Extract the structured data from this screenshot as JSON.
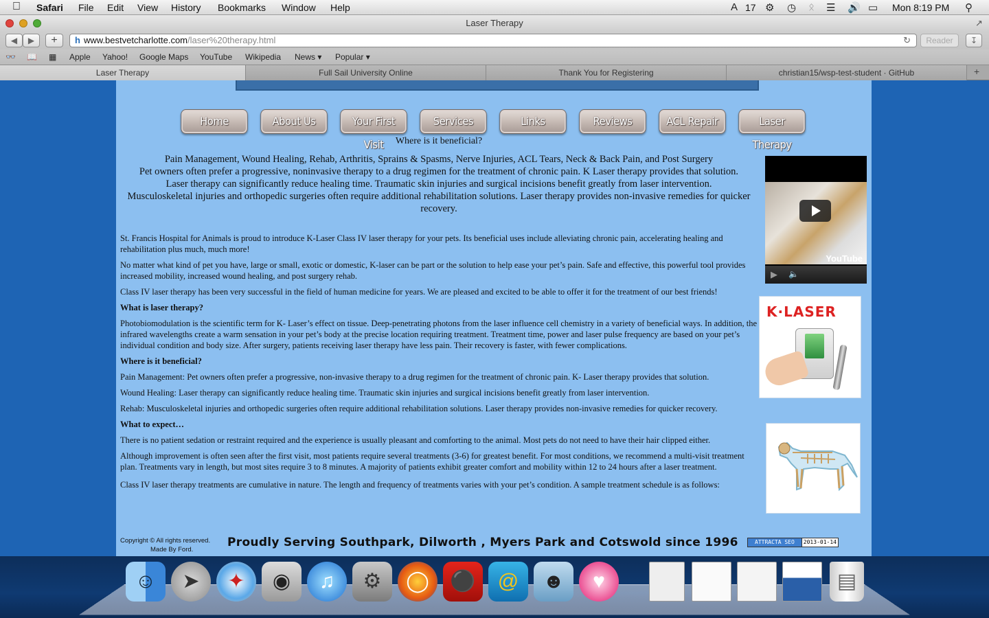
{
  "menubar": {
    "app_name": "Safari",
    "menus": [
      "File",
      "Edit",
      "View",
      "History",
      "Bookmarks",
      "Window",
      "Help"
    ],
    "status_notifications": "17",
    "clock": "Mon 8:19 PM"
  },
  "window": {
    "title": "Laser Therapy"
  },
  "toolbar": {
    "url_domain": "www.bestvetcharlotte.com",
    "url_path": "/laser%20therapy.html",
    "reader_label": "Reader"
  },
  "bookmarks": [
    "Apple",
    "Yahoo!",
    "Google Maps",
    "YouTube",
    "Wikipedia",
    "News ▾",
    "Popular ▾"
  ],
  "tabs": [
    {
      "label": "Laser Therapy",
      "active": true
    },
    {
      "label": "Full Sail University Online",
      "active": false
    },
    {
      "label": "Thank You for Registering",
      "active": false
    },
    {
      "label": "christian15/wsp-test-student · GitHub",
      "active": false
    }
  ],
  "nav": [
    "Home",
    "About Us",
    "Your First Visit",
    "Services",
    "Links",
    "Reviews",
    "ACL Repair",
    "Laser Therapy"
  ],
  "hero": {
    "question": "Where is it beneficial?",
    "conditions": "Pain Management, Wound Healing, Rehab, Arthritis, Sprains & Spasms, Nerve Injuries, ACL Tears, Neck & Back Pain, and Post Surgery",
    "paragraph1": "Pet owners often prefer a progressive, noninvasive therapy to a drug regimen for the treatment of chronic pain. K Laser therapy provides that solution.",
    "paragraph2": "Laser therapy can significantly reduce healing time. Traumatic skin injuries and surgical incisions benefit greatly from laser intervention.",
    "paragraph3": "Musculoskeletal injuries and orthopedic surgeries often require additional rehabilitation solutions. Laser therapy provides non-invasive remedies for quicker recovery."
  },
  "body": {
    "intro": " St. Francis Hospital for Animals is proud to introduce K-Laser Class IV laser therapy for your pets.  Its beneficial uses include alleviating chronic pain, accelerating healing and rehabilitation plus much, much more!",
    "any_pet": "No matter what kind of pet you have, large or small, exotic or domestic, K-laser can be part or the solution to help ease your pet’s pain. Safe and effective, this powerful tool provides increased mobility, increased wound healing, and post surgery rehab.",
    "class_iv": "Class IV laser therapy has been very successful in the field of human medicine for years. We are pleased and excited to be able to offer it for the treatment of our best friends!",
    "what_heading": "What is laser therapy?",
    "what_text": "Photobiomodulation is the scientific term for K- Laser’s effect on tissue. Deep-penetrating photons from the laser influence cell chemistry in a variety of beneficial ways. In addition, the infrared wavelengths create a warm sensation in your pet’s body at the precise location requiring treatment. Treatment time, power and laser pulse frequency are based on your pet’s individual condition and body size. After surgery, patients receiving laser therapy have less pain. Their recovery is faster, with fewer complications.",
    "where_heading": "Where is it beneficial?",
    "pain": "Pain Management: Pet owners often prefer a progressive, non-invasive therapy to a drug regimen for the treatment of chronic pain. K- Laser therapy provides that solution.",
    "wound": "Wound Healing: Laser therapy can significantly reduce healing time. Traumatic skin injuries and surgical incisions benefit greatly from laser intervention.",
    "rehab": "Rehab: Musculoskeletal injuries and orthopedic surgeries often require additional rehabilitation solutions. Laser therapy provides non-invasive remedies for quicker recovery.",
    "expect_heading": "What to expect…",
    "expect1": "There is no patient sedation or restraint required and the experience is usually pleasant and comforting to the animal. Most pets do not need to have their hair clipped either.",
    "expect2": "Although improvement is often seen after the first visit, most patients require several treatments (3-6) for greatest benefit. For most conditions, we recommend a multi-visit treatment plan. Treatments vary in length, but most sites require 3 to 8 minutes. A majority of patients exhibit greater comfort and mobility within 12 to 24 hours after a laser treatment.",
    "cumulative": "Class IV laser therapy treatments are cumulative in nature. The length and frequency of treatments varies with your pet’s condition. A sample treatment schedule is as follows:"
  },
  "sidebar": {
    "video_brand": "YouTube",
    "klaser_logo": "K·LASER"
  },
  "footer": {
    "copyright": "Copyright © All rights reserved.",
    "made_by": "Made By Ford.",
    "tagline": "Proudly Serving Southpark, Dilworth , Myers Park and Cotswold since 1996",
    "badge_label": "ATTRACTA SEO",
    "badge_date": "2013-01-14"
  },
  "dock": [
    "finder-icon",
    "launchpad-icon",
    "safari-icon",
    "facetime-icon",
    "itunes-icon",
    "system-preferences-icon",
    "firefox-icon",
    "acrobat-icon",
    "fetch-icon",
    "github-icon",
    "heart-app-icon",
    "window-thumb-icon",
    "window-thumb-icon",
    "window-thumb-icon",
    "window-thumb-icon",
    "trash-icon"
  ]
}
